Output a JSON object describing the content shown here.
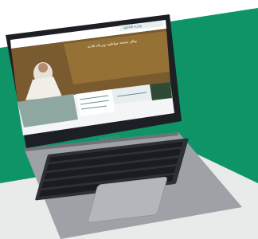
{
  "scene": {
    "background_color": "#ffffff",
    "band_color": "#0f9468",
    "laptop_body_color": "#9ea1a6",
    "laptop_dark_color": "#2d3035",
    "screen_bezel_color": "#1c1f23"
  },
  "website": {
    "logo_text": "وزارة الداخلية",
    "nav_items": [
      "الرئيسية",
      "الوزارة",
      "الخدمات",
      "الأخبار",
      "تواصل معنا"
    ],
    "hero_heading": "وطن يصنعه مواطنيه ويرعاه قادته"
  }
}
